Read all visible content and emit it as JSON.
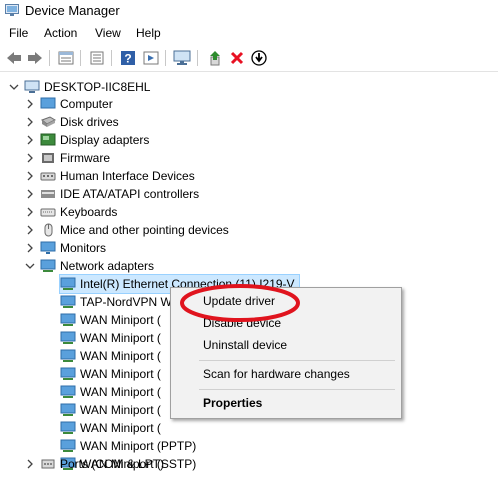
{
  "window": {
    "title": "Device Manager"
  },
  "menu": [
    "File",
    "Action",
    "View",
    "Help"
  ],
  "toolbar": [
    {
      "name": "back-icon"
    },
    {
      "name": "forward-icon"
    },
    {
      "name": "properties-icon"
    },
    {
      "name": "list-icon"
    },
    {
      "name": "help-icon"
    },
    {
      "name": "view-icon"
    },
    {
      "name": "monitor-icon"
    },
    {
      "name": "update-driver-icon"
    },
    {
      "name": "uninstall-icon"
    },
    {
      "name": "download-icon"
    }
  ],
  "tree": {
    "root": "DESKTOP-IIC8EHL",
    "categories": [
      "Computer",
      "Disk drives",
      "Display adapters",
      "Firmware",
      "Human Interface Devices",
      "IDE ATA/ATAPI controllers",
      "Keyboards",
      "Mice and other pointing devices",
      "Monitors",
      "Network adapters"
    ],
    "network_children": [
      "Intel(R) Ethernet Connection (11) I219-V",
      "TAP-NordVPN Windows Adapter V9",
      "WAN Miniport (",
      "WAN Miniport (",
      "WAN Miniport (",
      "WAN Miniport (",
      "WAN Miniport (",
      "WAN Miniport (",
      "WAN Miniport (",
      "WAN Miniport (PPTP)",
      "WAN Miniport (SSTP)"
    ],
    "after": "Ports (COM & LPT)"
  },
  "context_menu": {
    "update": "Update driver",
    "disable": "Disable device",
    "uninstall": "Uninstall device",
    "scan": "Scan for hardware changes",
    "properties": "Properties"
  },
  "colors": {
    "highlight": "#cce8ff",
    "annotation": "#e0141e",
    "uninstall": "#e81123",
    "update": "#2e8b2e"
  }
}
